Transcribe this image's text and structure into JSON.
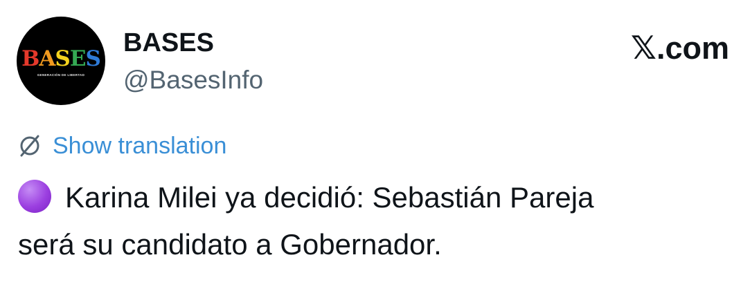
{
  "author": {
    "display_name": "BASES",
    "handle": "@BasesInfo",
    "avatar": {
      "logo_text": "BASES",
      "logo_subtext": "GENERACIÓN DE LIBERTAD",
      "logo_letter_colors": [
        "#e5392b",
        "#f29a1f",
        "#f4d21e",
        "#34a853",
        "#2f7bd8"
      ]
    }
  },
  "site": {
    "label_glyph": "𝕏",
    "label_suffix": ".com"
  },
  "translation": {
    "icon": "translate-globe-icon",
    "label": "Show translation",
    "color": "#3a8fd6"
  },
  "tweet": {
    "emoji": "purple-circle-emoji",
    "emoji_color": "#9b3fe0",
    "line1": "Karina Milei ya decidió: Sebastián Pareja",
    "line2": "será su candidato a Gobernador."
  }
}
